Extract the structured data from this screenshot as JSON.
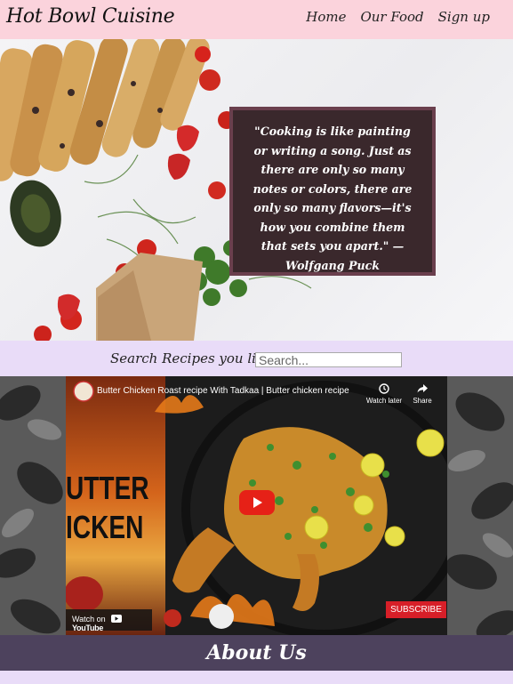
{
  "header": {
    "brand": "Hot Bowl Cuisine",
    "nav": [
      "Home",
      "Our Food",
      "Sign up"
    ]
  },
  "hero": {
    "quote": "\"Cooking is like painting or writing a song. Just as there are only so many notes or colors, there are only so many flavors—it's how you combine them that sets you apart.\" — Wolfgang Puck"
  },
  "search": {
    "label": "Search Recipes you like :",
    "placeholder": "Search..."
  },
  "video": {
    "title": "Butter Chicken Roast recipe With Tadkaa | Butter chicken recipe",
    "watch_later": "Watch later",
    "share": "Share",
    "thumb_line1": "UTTER",
    "thumb_line2": "ICKEN",
    "watch_on": "Watch on",
    "youtube": "YouTube",
    "subscribe": "SUBSCRIBE"
  },
  "about": {
    "title": "About Us"
  },
  "colors": {
    "nav_bg": "#fbd3dc",
    "search_bg": "#e9dcf8",
    "quote_bg": "#3a282c",
    "quote_border": "#6a3f4d",
    "about_bg": "#4d425d",
    "subscribe_red": "#d71f28"
  }
}
